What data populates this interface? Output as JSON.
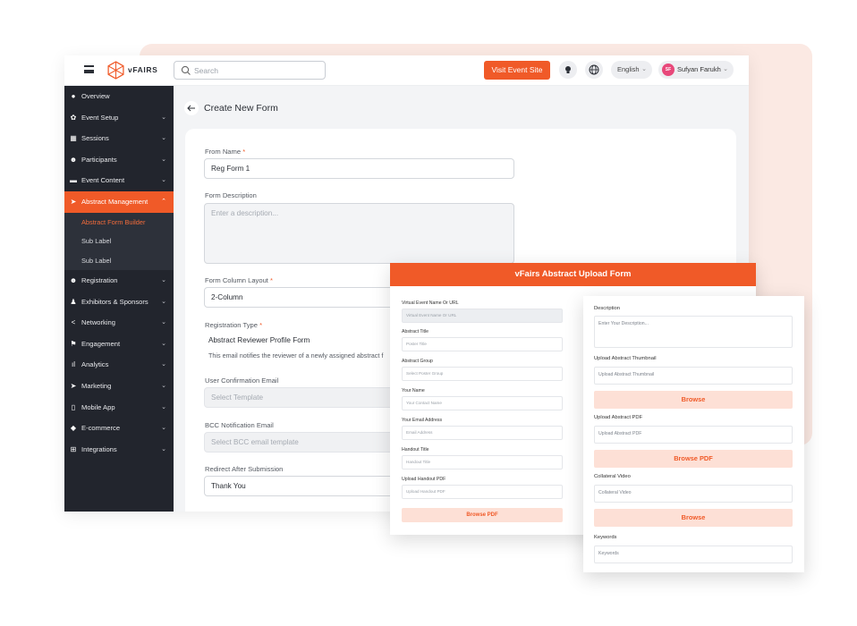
{
  "brand": {
    "logo_text": "vFAIRS",
    "accent": "#f05a28"
  },
  "topbar": {
    "search_placeholder": "Search",
    "visit_label": "Visit Event Site",
    "language": "English",
    "user_initials": "SF",
    "user_name": "Sufyan Farukh"
  },
  "sidebar": {
    "items": [
      {
        "label": "Overview",
        "icon": "info-icon"
      },
      {
        "label": "Event Setup",
        "icon": "gear-icon"
      },
      {
        "label": "Sessions",
        "icon": "grid-icon"
      },
      {
        "label": "Participants",
        "icon": "people-icon"
      },
      {
        "label": "Event Content",
        "icon": "folder-icon"
      },
      {
        "label": "Abstract Management",
        "icon": "send-icon"
      },
      {
        "label": "Registration",
        "icon": "user-add-icon"
      },
      {
        "label": "Exhibitors & Sponsors",
        "icon": "person-icon"
      },
      {
        "label": "Networking",
        "icon": "share-icon"
      },
      {
        "label": "Engagement",
        "icon": "flag-icon"
      },
      {
        "label": "Analytics",
        "icon": "bar-chart-icon"
      },
      {
        "label": "Marketing",
        "icon": "send-icon"
      },
      {
        "label": "Mobile App",
        "icon": "phone-icon"
      },
      {
        "label": "E-commerce",
        "icon": "box-icon"
      },
      {
        "label": "Integrations",
        "icon": "plus-square-icon"
      }
    ],
    "sub_items": [
      "Abstract Form Builder",
      "Sub Label",
      "Sub Label"
    ]
  },
  "page": {
    "title": "Create New Form",
    "form_name_label": "From Name",
    "form_name_value": "Reg Form 1",
    "description_label": "Form Description",
    "description_placeholder": "Enter a description...",
    "column_layout_label": "Form Column Layout",
    "column_layout_value": "2-Column",
    "reg_type_label": "Registration Type",
    "reg_type_value": "Abstract Reviewer Profile Form",
    "reg_type_note": "This email notifies the reviewer of a newly assigned abstract f",
    "user_email_label": "User Confirmation Email",
    "user_email_placeholder": "Select Template",
    "bcc_label": "BCC Notification Email",
    "bcc_placeholder": "Select BCC email template",
    "redirect_label": "Redirect After Submission",
    "redirect_value": "Thank You",
    "required_mark": "*"
  },
  "preview_left": {
    "title": "vFairs Abstract Upload Form",
    "fields": [
      {
        "label": "Virtual Event Name Or URL",
        "placeholder": "Virtual Event Name Or URL"
      },
      {
        "label": "Abstract Title",
        "placeholder": "Poster Title"
      },
      {
        "label": "Abstract Group",
        "placeholder": "Select Poster Group"
      },
      {
        "label": "Your Name",
        "placeholder": "Your Contact Name"
      },
      {
        "label": "Your Email Address",
        "placeholder": "Email Address"
      },
      {
        "label": "Handout Title",
        "placeholder": "Handout Title"
      },
      {
        "label": "Upload Handout PDF",
        "placeholder": "Upload Handout PDF"
      }
    ],
    "button": "Browse PDF"
  },
  "preview_right": {
    "description_label": "Description",
    "description_placeholder": "Enter Your Description...",
    "thumb_label": "Upload Abstract Thumbnail",
    "thumb_placeholder": "Upload Abstract Thumbnail",
    "browse1": "Browse",
    "pdf_label": "Upload Abstract PDF",
    "pdf_placeholder": "Upload Abstract PDF",
    "browse_pdf": "Browse PDF",
    "video_label": "Collateral Video",
    "video_placeholder": "Collateral Video",
    "browse2": "Browse",
    "keywords_label": "Keywords",
    "keywords_placeholder": "Keywords"
  }
}
